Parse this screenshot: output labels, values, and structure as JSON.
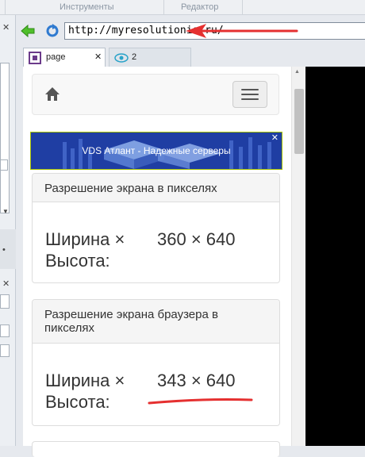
{
  "ribbon": {
    "tab_tools": "Инструменты",
    "tab_editor": "Редактор"
  },
  "browser": {
    "url": "http://myresolutionis.ru/",
    "tabs": [
      {
        "label": "page"
      },
      {
        "label": "2"
      }
    ]
  },
  "ad": {
    "text": "VDS Атлант - Надежные серверы",
    "close": "✕"
  },
  "screen_resolution": {
    "title": "Разрешение экрана в пикселях",
    "label_line1": "Ширина ×",
    "label_line2": "Высота:",
    "value": "360 × 640"
  },
  "browser_resolution": {
    "title_line1": "Разрешение экрана браузера в",
    "title_line2": "пикселях",
    "label_line1": "Ширина ×",
    "label_line2": "Высота:",
    "value": "343 × 640"
  },
  "colors": {
    "annotation_red": "#e53030",
    "ad_border": "#a6c200"
  }
}
